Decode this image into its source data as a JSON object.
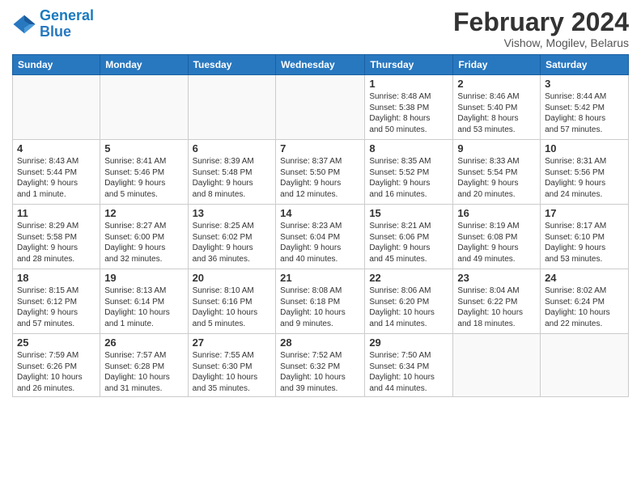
{
  "logo": {
    "line1": "General",
    "line2": "Blue"
  },
  "title": "February 2024",
  "subtitle": "Vishow, Mogilev, Belarus",
  "weekdays": [
    "Sunday",
    "Monday",
    "Tuesday",
    "Wednesday",
    "Thursday",
    "Friday",
    "Saturday"
  ],
  "weeks": [
    [
      {
        "day": "",
        "info": ""
      },
      {
        "day": "",
        "info": ""
      },
      {
        "day": "",
        "info": ""
      },
      {
        "day": "",
        "info": ""
      },
      {
        "day": "1",
        "info": "Sunrise: 8:48 AM\nSunset: 5:38 PM\nDaylight: 8 hours\nand 50 minutes."
      },
      {
        "day": "2",
        "info": "Sunrise: 8:46 AM\nSunset: 5:40 PM\nDaylight: 8 hours\nand 53 minutes."
      },
      {
        "day": "3",
        "info": "Sunrise: 8:44 AM\nSunset: 5:42 PM\nDaylight: 8 hours\nand 57 minutes."
      }
    ],
    [
      {
        "day": "4",
        "info": "Sunrise: 8:43 AM\nSunset: 5:44 PM\nDaylight: 9 hours\nand 1 minute."
      },
      {
        "day": "5",
        "info": "Sunrise: 8:41 AM\nSunset: 5:46 PM\nDaylight: 9 hours\nand 5 minutes."
      },
      {
        "day": "6",
        "info": "Sunrise: 8:39 AM\nSunset: 5:48 PM\nDaylight: 9 hours\nand 8 minutes."
      },
      {
        "day": "7",
        "info": "Sunrise: 8:37 AM\nSunset: 5:50 PM\nDaylight: 9 hours\nand 12 minutes."
      },
      {
        "day": "8",
        "info": "Sunrise: 8:35 AM\nSunset: 5:52 PM\nDaylight: 9 hours\nand 16 minutes."
      },
      {
        "day": "9",
        "info": "Sunrise: 8:33 AM\nSunset: 5:54 PM\nDaylight: 9 hours\nand 20 minutes."
      },
      {
        "day": "10",
        "info": "Sunrise: 8:31 AM\nSunset: 5:56 PM\nDaylight: 9 hours\nand 24 minutes."
      }
    ],
    [
      {
        "day": "11",
        "info": "Sunrise: 8:29 AM\nSunset: 5:58 PM\nDaylight: 9 hours\nand 28 minutes."
      },
      {
        "day": "12",
        "info": "Sunrise: 8:27 AM\nSunset: 6:00 PM\nDaylight: 9 hours\nand 32 minutes."
      },
      {
        "day": "13",
        "info": "Sunrise: 8:25 AM\nSunset: 6:02 PM\nDaylight: 9 hours\nand 36 minutes."
      },
      {
        "day": "14",
        "info": "Sunrise: 8:23 AM\nSunset: 6:04 PM\nDaylight: 9 hours\nand 40 minutes."
      },
      {
        "day": "15",
        "info": "Sunrise: 8:21 AM\nSunset: 6:06 PM\nDaylight: 9 hours\nand 45 minutes."
      },
      {
        "day": "16",
        "info": "Sunrise: 8:19 AM\nSunset: 6:08 PM\nDaylight: 9 hours\nand 49 minutes."
      },
      {
        "day": "17",
        "info": "Sunrise: 8:17 AM\nSunset: 6:10 PM\nDaylight: 9 hours\nand 53 minutes."
      }
    ],
    [
      {
        "day": "18",
        "info": "Sunrise: 8:15 AM\nSunset: 6:12 PM\nDaylight: 9 hours\nand 57 minutes."
      },
      {
        "day": "19",
        "info": "Sunrise: 8:13 AM\nSunset: 6:14 PM\nDaylight: 10 hours\nand 1 minute."
      },
      {
        "day": "20",
        "info": "Sunrise: 8:10 AM\nSunset: 6:16 PM\nDaylight: 10 hours\nand 5 minutes."
      },
      {
        "day": "21",
        "info": "Sunrise: 8:08 AM\nSunset: 6:18 PM\nDaylight: 10 hours\nand 9 minutes."
      },
      {
        "day": "22",
        "info": "Sunrise: 8:06 AM\nSunset: 6:20 PM\nDaylight: 10 hours\nand 14 minutes."
      },
      {
        "day": "23",
        "info": "Sunrise: 8:04 AM\nSunset: 6:22 PM\nDaylight: 10 hours\nand 18 minutes."
      },
      {
        "day": "24",
        "info": "Sunrise: 8:02 AM\nSunset: 6:24 PM\nDaylight: 10 hours\nand 22 minutes."
      }
    ],
    [
      {
        "day": "25",
        "info": "Sunrise: 7:59 AM\nSunset: 6:26 PM\nDaylight: 10 hours\nand 26 minutes."
      },
      {
        "day": "26",
        "info": "Sunrise: 7:57 AM\nSunset: 6:28 PM\nDaylight: 10 hours\nand 31 minutes."
      },
      {
        "day": "27",
        "info": "Sunrise: 7:55 AM\nSunset: 6:30 PM\nDaylight: 10 hours\nand 35 minutes."
      },
      {
        "day": "28",
        "info": "Sunrise: 7:52 AM\nSunset: 6:32 PM\nDaylight: 10 hours\nand 39 minutes."
      },
      {
        "day": "29",
        "info": "Sunrise: 7:50 AM\nSunset: 6:34 PM\nDaylight: 10 hours\nand 44 minutes."
      },
      {
        "day": "",
        "info": ""
      },
      {
        "day": "",
        "info": ""
      }
    ]
  ]
}
